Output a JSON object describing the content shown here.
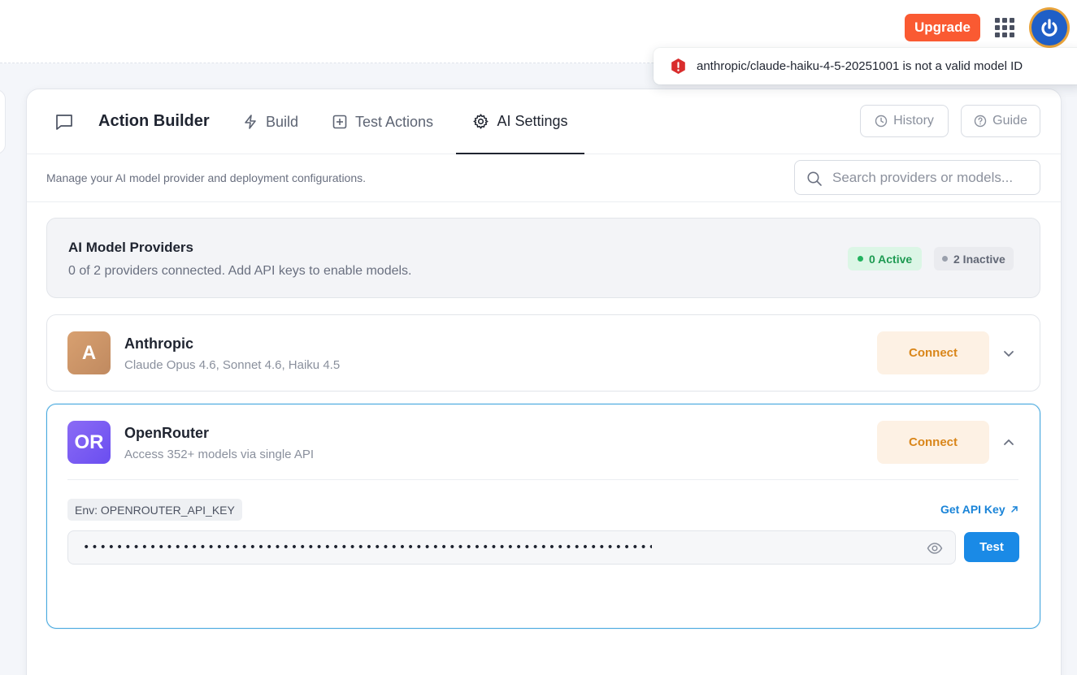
{
  "topbar": {
    "upgrade_label": "Upgrade"
  },
  "toast": {
    "message": "anthropic/claude-haiku-4-5-20251001 is not a valid model ID"
  },
  "header": {
    "title": "Action Builder",
    "tabs": [
      {
        "label": "Build"
      },
      {
        "label": "Test Actions"
      },
      {
        "label": "AI Settings",
        "active": true
      }
    ],
    "history_label": "History",
    "guide_label": "Guide"
  },
  "subbar": {
    "description": "Manage your AI model provider and deployment configurations.",
    "search_placeholder": "Search providers or models..."
  },
  "summary": {
    "title": "AI Model Providers",
    "subtitle": "0 of 2 providers connected. Add API keys to enable models.",
    "active_badge": "0 Active",
    "inactive_badge": "2 Inactive"
  },
  "providers": [
    {
      "logo": "A",
      "name": "Anthropic",
      "description": "Claude Opus 4.6, Sonnet 4.6, Haiku 4.5",
      "connect_label": "Connect",
      "expanded": false
    },
    {
      "logo": "OR",
      "name": "OpenRouter",
      "description": "Access 352+ models via single API",
      "connect_label": "Connect",
      "expanded": true,
      "env_tag": "Env: OPENROUTER_API_KEY",
      "get_key_label": "Get API Key",
      "api_key_masked": "•••••••••••••••••••••••••••••••••••••••••••••••••••••••••••••••••••••••••",
      "test_label": "Test"
    }
  ],
  "colors": {
    "upgrade": "#fa5a32",
    "accent_blue": "#1a8ae6",
    "connect_text": "#d9861a",
    "active_green": "#1e9a52",
    "error_red": "#d92d2d"
  }
}
